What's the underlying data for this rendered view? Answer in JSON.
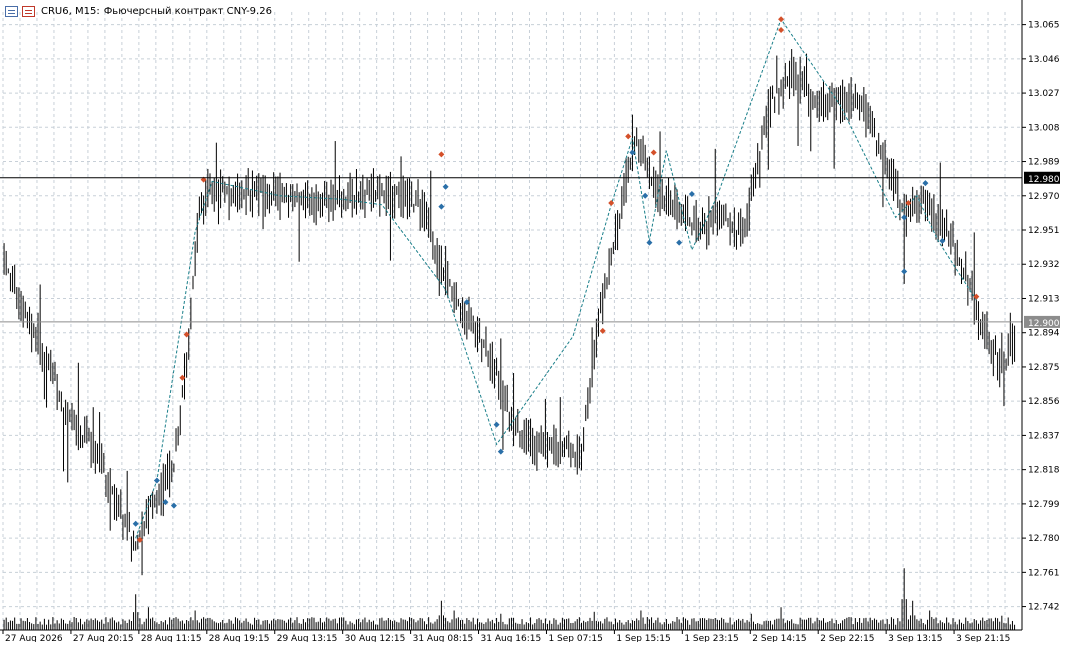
{
  "header": {
    "symbol": "CRU6, M15:",
    "description": "Фьючерсный контракт CNY-9.26"
  },
  "colors": {
    "background": "#ffffff",
    "grid": "#c8d0d8",
    "candle": "#000000",
    "zigzag": "#1a7f8a",
    "marker_up": "#d4502a",
    "marker_down": "#2a6fa8",
    "price_label_bg": "#000000",
    "current_label_bg": "#8c8c8c"
  },
  "chart_data": {
    "type": "ohlc",
    "y_range": [
      12.729,
      13.072
    ],
    "y_ticks": [
      "13.065",
      "13.046",
      "13.027",
      "13.008",
      "12.989",
      "12.970",
      "12.951",
      "12.932",
      "12.913",
      "12.894",
      "12.875",
      "12.856",
      "12.837",
      "12.818",
      "12.799",
      "12.780",
      "12.761",
      "12.742"
    ],
    "x_labels": [
      "27 Aug 2026",
      "27 Aug 20:15",
      "28 Aug 11:15",
      "28 Aug 19:15",
      "29 Aug 13:15",
      "30 Aug 12:15",
      "31 Aug 08:15",
      "31 Aug 16:15",
      "1 Sep 07:15",
      "1 Sep 15:15",
      "1 Sep 23:15",
      "2 Sep 14:15",
      "2 Sep 22:15",
      "3 Sep 13:15",
      "3 Sep 21:15"
    ],
    "horizontal_lines": [
      {
        "price": 12.98,
        "label": "12.980",
        "style": "level"
      },
      {
        "price": 12.9,
        "label": "12.900",
        "style": "current"
      }
    ],
    "trend_anchors": [
      [
        0,
        12.93
      ],
      [
        12,
        12.9
      ],
      [
        22,
        12.875
      ],
      [
        30,
        12.845
      ],
      [
        40,
        12.835
      ],
      [
        48,
        12.815
      ],
      [
        56,
        12.79
      ],
      [
        62,
        12.775
      ],
      [
        70,
        12.8
      ],
      [
        80,
        12.82
      ],
      [
        86,
        12.88
      ],
      [
        92,
        12.96
      ],
      [
        98,
        12.975
      ],
      [
        120,
        12.972
      ],
      [
        150,
        12.968
      ],
      [
        178,
        12.972
      ],
      [
        196,
        12.965
      ],
      [
        208,
        12.925
      ],
      [
        218,
        12.905
      ],
      [
        230,
        12.88
      ],
      [
        240,
        12.84
      ],
      [
        252,
        12.83
      ],
      [
        262,
        12.832
      ],
      [
        272,
        12.828
      ],
      [
        280,
        12.9
      ],
      [
        290,
        12.96
      ],
      [
        298,
        13.005
      ],
      [
        306,
        12.975
      ],
      [
        316,
        12.965
      ],
      [
        328,
        12.95
      ],
      [
        338,
        12.96
      ],
      [
        348,
        12.945
      ],
      [
        360,
        13.02
      ],
      [
        372,
        13.04
      ],
      [
        382,
        13.02
      ],
      [
        394,
        13.025
      ],
      [
        404,
        13.02
      ],
      [
        416,
        12.985
      ],
      [
        424,
        12.96
      ],
      [
        434,
        12.968
      ],
      [
        444,
        12.95
      ],
      [
        452,
        12.93
      ],
      [
        460,
        12.9
      ],
      [
        470,
        12.875
      ],
      [
        476,
        12.89
      ]
    ],
    "zigzag": [
      [
        62,
        12.78
      ],
      [
        72,
        12.812
      ],
      [
        90,
        12.95
      ],
      [
        98,
        12.978
      ],
      [
        130,
        12.97
      ],
      [
        160,
        12.968
      ],
      [
        178,
        12.965
      ],
      [
        208,
        12.918
      ],
      [
        232,
        12.832
      ],
      [
        268,
        12.892
      ],
      [
        286,
        12.965
      ],
      [
        296,
        13.002
      ],
      [
        304,
        12.945
      ],
      [
        312,
        12.995
      ],
      [
        324,
        12.94
      ],
      [
        336,
        12.97
      ],
      [
        366,
        13.068
      ],
      [
        394,
        13.02
      ],
      [
        420,
        12.958
      ],
      [
        430,
        12.97
      ],
      [
        440,
        12.945
      ],
      [
        458,
        12.912
      ]
    ],
    "markers_up": [
      [
        64,
        12.779
      ],
      [
        84,
        12.869
      ],
      [
        86,
        12.893
      ],
      [
        94,
        12.979
      ],
      [
        206,
        12.993
      ],
      [
        282,
        12.895
      ],
      [
        286,
        12.966
      ],
      [
        294,
        13.003
      ],
      [
        306,
        12.994
      ],
      [
        366,
        13.068
      ],
      [
        366,
        13.062
      ],
      [
        426,
        12.966
      ],
      [
        458,
        12.914
      ]
    ],
    "markers_down": [
      [
        62,
        12.788
      ],
      [
        72,
        12.812
      ],
      [
        76,
        12.8
      ],
      [
        80,
        12.798
      ],
      [
        206,
        12.964
      ],
      [
        208,
        12.975
      ],
      [
        218,
        12.911
      ],
      [
        232,
        12.843
      ],
      [
        234,
        12.828
      ],
      [
        296,
        12.994
      ],
      [
        302,
        12.97
      ],
      [
        304,
        12.944
      ],
      [
        318,
        12.944
      ],
      [
        324,
        12.971
      ],
      [
        424,
        12.928
      ],
      [
        424,
        12.958
      ],
      [
        434,
        12.977
      ],
      [
        442,
        12.945
      ]
    ],
    "volume_spikes": [
      [
        62,
        0.55
      ],
      [
        68,
        0.35
      ],
      [
        90,
        0.3
      ],
      [
        206,
        0.45
      ],
      [
        212,
        0.3
      ],
      [
        234,
        0.25
      ],
      [
        278,
        0.28
      ],
      [
        300,
        0.3
      ],
      [
        352,
        0.25
      ],
      [
        366,
        0.35
      ],
      [
        424,
        0.95
      ],
      [
        428,
        0.45
      ],
      [
        436,
        0.3
      ],
      [
        470,
        0.22
      ]
    ]
  }
}
